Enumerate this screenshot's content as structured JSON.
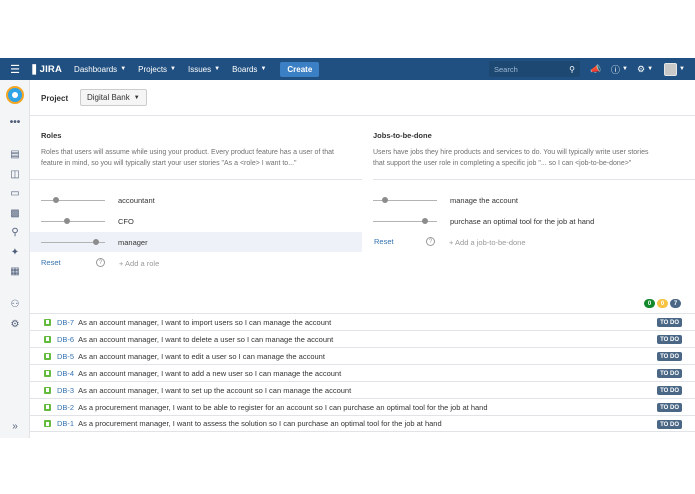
{
  "nav": {
    "logo": "JIRA",
    "items": [
      {
        "label": "Dashboards"
      },
      {
        "label": "Projects"
      },
      {
        "label": "Issues"
      },
      {
        "label": "Boards"
      }
    ],
    "create_label": "Create",
    "search_placeholder": "Search"
  },
  "project": {
    "label": "Project",
    "selected": "Digital Bank"
  },
  "roles": {
    "heading": "Roles",
    "description_line1": "Roles that users will assume while using your product. Every product feature has a user of that",
    "description_line2": "feature in mind, so you will typically start your user stories \"As a <role> I want to...\"",
    "items": [
      {
        "label": "accountant",
        "level": 0.2
      },
      {
        "label": "CFO",
        "level": 0.4
      },
      {
        "label": "manager",
        "level": 0.9
      }
    ],
    "reset_label": "Reset",
    "add_label": "+ Add a role"
  },
  "jobs": {
    "heading": "Jobs-to-be-done",
    "description_line1": "Users have jobs they hire products and services to do. You will typically write user stories",
    "description_line2": "that support the user role in completing a specific job \"... so I can <job-to-be-done>\"",
    "items": [
      {
        "label": "manage the account",
        "level": 0.15
      },
      {
        "label": "purchase an optimal tool for the job at hand",
        "level": 0.85
      }
    ],
    "reset_label": "Reset",
    "add_label": "+ Add a job-to-be-done"
  },
  "counts": [
    {
      "value": "0",
      "color": "#14892c"
    },
    {
      "value": "0",
      "color": "#f6c342"
    },
    {
      "value": "7",
      "color": "#4a6785"
    }
  ],
  "issues": [
    {
      "key": "DB-7",
      "summary": "As an account manager, I want to import users so I can manage the account",
      "status": "TO DO"
    },
    {
      "key": "DB-6",
      "summary": "As an account manager, I want to delete a user so I can manage the account",
      "status": "TO DO"
    },
    {
      "key": "DB-5",
      "summary": "As an account manager, I want to edit a user so I can manage the account",
      "status": "TO DO"
    },
    {
      "key": "DB-4",
      "summary": "As an account manager, I want to add a new user so I can manage the account",
      "status": "TO DO"
    },
    {
      "key": "DB-3",
      "summary": "As an account manager, I want to set up the account so I can manage the account",
      "status": "TO DO"
    },
    {
      "key": "DB-2",
      "summary": "As a procurement manager, I want to be able to register for an account so I can purchase an optimal tool for the job at hand",
      "status": "TO DO"
    },
    {
      "key": "DB-1",
      "summary": "As a procurement manager, I want to assess the solution so I can purchase an optimal tool for the job at hand",
      "status": "TO DO"
    }
  ],
  "colors": {
    "nav": "#205081",
    "accent": "#3b7fc4",
    "story": "#63ba3c",
    "status": "#4a6785"
  }
}
